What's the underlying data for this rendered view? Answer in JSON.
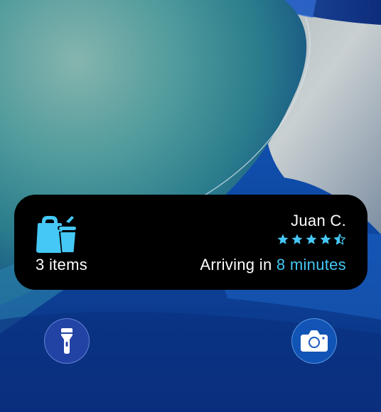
{
  "live_activity": {
    "items_label": "3 items",
    "courier_name": "Juan C.",
    "rating": 4.5,
    "arrival_prefix": "Arriving in",
    "arrival_eta": "8 minutes",
    "accent_color": "#45c8f5"
  },
  "icons": {
    "activity_icon": "takeout-bag-and-cup-icon",
    "star_icon": "star-icon",
    "flashlight": "flashlight-icon",
    "camera": "camera-icon"
  },
  "colors": {
    "card_background": "#000000",
    "text": "#ffffff",
    "accent": "#45c8f5"
  }
}
